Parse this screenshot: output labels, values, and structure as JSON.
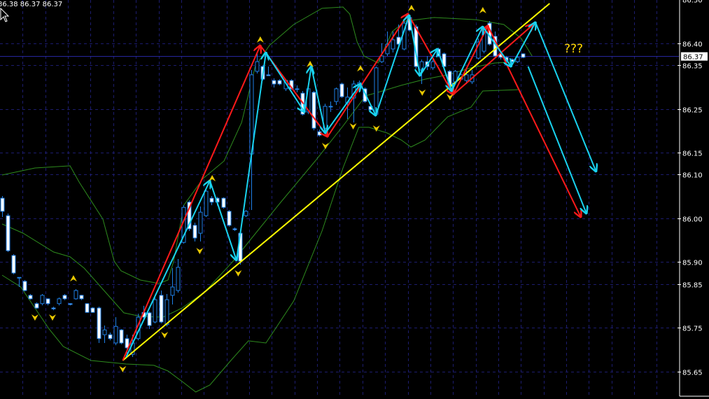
{
  "header": {
    "ohlc_readout": "86.38 86.37 86.37"
  },
  "annotation": {
    "question": "???"
  },
  "current_price": {
    "value": 86.37,
    "label": "86.37"
  },
  "colors": {
    "background": "#000000",
    "grid": "#1c1c6e",
    "bull": "#1e7fe6",
    "bear": "#ffffff",
    "bands": "#2e8b1e",
    "zigzag": "#ff1a1a",
    "swing": "#19d3f0",
    "trendline": "#ffff00",
    "fractal": "#e8c800",
    "price_line": "#2a2aa8"
  },
  "chart_data": {
    "type": "candlestick",
    "title": "",
    "xlabel": "",
    "ylabel": "",
    "ylim": [
      85.6,
      86.5
    ],
    "grid": true,
    "y_ticks": [
      "86.50",
      "86.40",
      "86.35",
      "86.25",
      "86.15",
      "86.10",
      "86.00",
      "85.90",
      "85.85",
      "85.75",
      "85.65"
    ],
    "candles_ohlc": [
      [
        86.046,
        86.051,
        86.003,
        86.016
      ],
      [
        86.006,
        86.011,
        85.923,
        85.926
      ],
      [
        85.915,
        85.918,
        85.872,
        85.875
      ],
      [
        85.865,
        85.865,
        85.843,
        85.864
      ],
      [
        85.856,
        85.859,
        85.833,
        85.835
      ],
      [
        85.824,
        85.827,
        85.814,
        85.816
      ],
      [
        85.805,
        85.808,
        85.793,
        85.795
      ],
      [
        85.805,
        85.827,
        85.801,
        85.824
      ],
      [
        85.816,
        85.817,
        85.801,
        85.805
      ],
      [
        85.795,
        85.798,
        85.79,
        85.793
      ],
      [
        85.805,
        85.819,
        85.801,
        85.816
      ],
      [
        85.824,
        85.827,
        85.813,
        85.816
      ],
      [
        85.805,
        85.806,
        85.801,
        85.803
      ],
      [
        85.816,
        85.838,
        85.814,
        85.835
      ],
      [
        85.824,
        85.825,
        85.813,
        85.816
      ],
      [
        85.805,
        85.806,
        85.784,
        85.785
      ],
      [
        85.795,
        85.797,
        85.784,
        85.785
      ],
      [
        85.795,
        85.798,
        85.715,
        85.725
      ],
      [
        85.734,
        85.755,
        85.715,
        85.745
      ],
      [
        85.734,
        85.739,
        85.721,
        85.725
      ],
      [
        85.715,
        85.774,
        85.71,
        85.753
      ],
      [
        85.745,
        85.747,
        85.712,
        85.715
      ],
      [
        85.725,
        85.734,
        85.688,
        85.704
      ],
      [
        85.689,
        85.734,
        85.683,
        85.715
      ],
      [
        85.725,
        85.782,
        85.721,
        85.774
      ],
      [
        85.785,
        85.8,
        85.771,
        85.774
      ],
      [
        85.784,
        85.787,
        85.747,
        85.755
      ],
      [
        85.763,
        85.819,
        85.76,
        85.814
      ],
      [
        85.824,
        85.835,
        85.76,
        85.763
      ],
      [
        85.757,
        85.827,
        85.753,
        85.814
      ],
      [
        85.824,
        85.886,
        85.803,
        85.843
      ],
      [
        85.835,
        85.907,
        85.83,
        85.888
      ],
      [
        85.945,
        86.03,
        85.942,
        86.025
      ],
      [
        86.037,
        86.041,
        85.971,
        85.976
      ],
      [
        85.984,
        85.99,
        85.947,
        85.955
      ],
      [
        85.966,
        86.027,
        85.947,
        86.014
      ],
      [
        86.006,
        86.067,
        86.003,
        86.062
      ],
      [
        86.046,
        86.051,
        86.03,
        86.037
      ],
      [
        86.046,
        86.049,
        86.029,
        86.037
      ],
      [
        86.046,
        86.048,
        86.022,
        86.025
      ],
      [
        86.016,
        86.019,
        85.981,
        85.984
      ],
      [
        85.976,
        85.979,
        85.971,
        85.974
      ],
      [
        85.966,
        85.971,
        85.894,
        85.902
      ],
      [
        86.006,
        86.019,
        86.003,
        86.016
      ],
      [
        86.147,
        86.339,
        86.019,
        86.328
      ],
      [
        86.336,
        86.379,
        86.331,
        86.358
      ],
      [
        86.347,
        86.35,
        86.315,
        86.318
      ],
      [
        86.328,
        86.347,
        86.326,
        86.326
      ],
      [
        86.315,
        86.32,
        86.299,
        86.307
      ],
      [
        86.315,
        86.318,
        86.304,
        86.307
      ],
      [
        86.296,
        86.318,
        86.291,
        86.315
      ],
      [
        86.315,
        86.318,
        86.294,
        86.296
      ],
      [
        86.296,
        86.304,
        86.288,
        86.296
      ],
      [
        86.286,
        86.291,
        86.235,
        86.238
      ],
      [
        86.243,
        86.299,
        86.238,
        86.296
      ],
      [
        86.288,
        86.291,
        86.201,
        86.206
      ],
      [
        86.198,
        86.203,
        86.187,
        86.19
      ],
      [
        86.206,
        86.262,
        86.203,
        86.256
      ],
      [
        86.256,
        86.267,
        86.243,
        86.256
      ],
      [
        86.267,
        86.299,
        86.259,
        86.296
      ],
      [
        86.307,
        86.31,
        86.275,
        86.278
      ],
      [
        86.264,
        86.299,
        86.227,
        86.277
      ],
      [
        86.275,
        86.315,
        86.219,
        86.307
      ],
      [
        86.296,
        86.315,
        86.291,
        86.31
      ],
      [
        86.296,
        86.299,
        86.264,
        86.267
      ],
      [
        86.256,
        86.259,
        86.243,
        86.248
      ],
      [
        86.238,
        86.347,
        86.235,
        86.344
      ],
      [
        86.358,
        86.4,
        86.355,
        86.371
      ],
      [
        86.376,
        86.427,
        86.371,
        86.398
      ],
      [
        86.387,
        86.427,
        86.379,
        86.408
      ],
      [
        86.414,
        86.443,
        86.395,
        86.398
      ],
      [
        86.387,
        86.451,
        86.384,
        86.446
      ],
      [
        86.459,
        86.464,
        86.427,
        86.43
      ],
      [
        86.438,
        86.443,
        86.342,
        86.347
      ],
      [
        86.339,
        86.363,
        86.307,
        86.358
      ],
      [
        86.358,
        86.371,
        86.339,
        86.347
      ],
      [
        86.344,
        86.363,
        86.339,
        86.358
      ],
      [
        86.387,
        86.39,
        86.368,
        86.371
      ],
      [
        86.376,
        86.379,
        86.339,
        86.347
      ],
      [
        86.336,
        86.339,
        86.299,
        86.302
      ],
      [
        86.312,
        86.339,
        86.307,
        86.336
      ],
      [
        86.318,
        86.339,
        86.315,
        86.328
      ],
      [
        86.315,
        86.339,
        86.307,
        86.328
      ],
      [
        86.312,
        86.339,
        86.307,
        86.328
      ],
      [
        86.366,
        86.411,
        86.363,
        86.403
      ],
      [
        86.382,
        86.438,
        86.377,
        86.435
      ],
      [
        86.446,
        86.451,
        86.395,
        86.398
      ],
      [
        86.416,
        86.427,
        86.368,
        86.371
      ],
      [
        86.376,
        86.379,
        86.363,
        86.368
      ],
      [
        86.368,
        86.371,
        86.355,
        86.36
      ],
      [
        86.363,
        86.366,
        86.352,
        86.358
      ],
      [
        86.358,
        86.371,
        86.355,
        86.368
      ],
      [
        86.376,
        86.377,
        86.366,
        86.368
      ]
    ],
    "bollinger_bands": {
      "upper": [
        [
          0,
          86.099
        ],
        [
          5.8,
          86.115
        ],
        [
          12,
          86.12
        ],
        [
          13.6,
          86.083
        ],
        [
          17.8,
          85.998
        ],
        [
          19.8,
          85.902
        ],
        [
          21,
          85.88
        ],
        [
          24.4,
          85.859
        ],
        [
          27.7,
          85.851
        ],
        [
          29.3,
          85.859
        ],
        [
          30.3,
          85.902
        ],
        [
          32.1,
          86.03
        ],
        [
          35.5,
          86.091
        ],
        [
          39.2,
          86.131
        ],
        [
          42.3,
          86.219
        ],
        [
          44.7,
          86.347
        ],
        [
          47.2,
          86.395
        ],
        [
          51.5,
          86.443
        ],
        [
          56.5,
          86.48
        ],
        [
          60.2,
          86.483
        ],
        [
          61.4,
          86.467
        ],
        [
          62.7,
          86.403
        ],
        [
          63.9,
          86.371
        ],
        [
          66.4,
          86.355
        ],
        [
          68.9,
          86.427
        ],
        [
          71.3,
          86.451
        ],
        [
          76.3,
          86.459
        ],
        [
          83.7,
          86.454
        ],
        [
          88.6,
          86.443
        ],
        [
          91.7,
          86.411
        ],
        [
          93.6,
          86.371
        ]
      ],
      "middle": [
        [
          0,
          85.987
        ],
        [
          3.7,
          85.966
        ],
        [
          9.1,
          85.923
        ],
        [
          12,
          85.912
        ],
        [
          14.5,
          85.886
        ],
        [
          18.2,
          85.832
        ],
        [
          21.5,
          85.784
        ],
        [
          24.4,
          85.776
        ],
        [
          28.4,
          85.774
        ],
        [
          31.8,
          85.795
        ],
        [
          35.8,
          85.832
        ],
        [
          40.8,
          85.902
        ],
        [
          44.1,
          85.955
        ],
        [
          49.1,
          86.035
        ],
        [
          55.3,
          86.131
        ],
        [
          60.2,
          86.211
        ],
        [
          64.2,
          86.28
        ],
        [
          66.4,
          86.288
        ],
        [
          70.5,
          86.304
        ],
        [
          74.7,
          86.318
        ],
        [
          78.7,
          86.328
        ],
        [
          82.8,
          86.344
        ],
        [
          87,
          86.355
        ],
        [
          91.1,
          86.358
        ]
      ],
      "lower": [
        [
          0,
          85.87
        ],
        [
          3.3,
          85.843
        ],
        [
          5.8,
          85.795
        ],
        [
          8.3,
          85.747
        ],
        [
          10.8,
          85.707
        ],
        [
          15.7,
          85.675
        ],
        [
          21.9,
          85.667
        ],
        [
          26.8,
          85.664
        ],
        [
          29.3,
          85.651
        ],
        [
          31.8,
          85.627
        ],
        [
          34.2,
          85.603
        ],
        [
          36.7,
          85.619
        ],
        [
          40.4,
          85.675
        ],
        [
          43.5,
          85.72
        ],
        [
          46.6,
          85.715
        ],
        [
          51.5,
          85.811
        ],
        [
          56.5,
          85.971
        ],
        [
          60.2,
          86.115
        ],
        [
          63,
          86.208
        ],
        [
          64.8,
          86.208
        ],
        [
          68,
          86.195
        ],
        [
          70.5,
          86.179
        ],
        [
          72.2,
          86.163
        ],
        [
          74.7,
          86.179
        ],
        [
          78.7,
          86.232
        ],
        [
          82.8,
          86.254
        ],
        [
          84.9,
          86.291
        ],
        [
          91.1,
          86.294
        ]
      ]
    },
    "zigzag_red": [
      [
        [
          21.3,
          85.675
        ],
        [
          45.6,
          86.395
        ]
      ],
      [
        [
          45.6,
          86.395
        ],
        [
          57.5,
          86.187
        ]
      ],
      [
        [
          57.5,
          86.187
        ],
        [
          71.7,
          86.467
        ]
      ],
      [
        [
          71.7,
          86.467
        ],
        [
          79.7,
          86.283
        ]
      ],
      [
        [
          79.7,
          86.283
        ],
        [
          85.8,
          86.44
        ]
      ],
      [
        [
          85.8,
          86.44
        ],
        [
          102.2,
          86.003
        ]
      ],
      [
        [
          79.7,
          86.283
        ],
        [
          93.8,
          86.443
        ]
      ]
    ],
    "swings_cyan": [
      [
        [
          21.9,
          85.683
        ],
        [
          36.7,
          86.086
        ]
      ],
      [
        [
          36.7,
          86.086
        ],
        [
          41.4,
          85.904
        ]
      ],
      [
        [
          41.4,
          85.904
        ],
        [
          46.6,
          86.379
        ]
      ],
      [
        [
          46.6,
          86.379
        ],
        [
          53.4,
          86.243
        ]
      ],
      [
        [
          53.4,
          86.243
        ],
        [
          54.6,
          86.347
        ]
      ],
      [
        [
          54.6,
          86.347
        ],
        [
          57.1,
          86.195
        ]
      ],
      [
        [
          57.1,
          86.195
        ],
        [
          63.3,
          86.307
        ]
      ],
      [
        [
          63.3,
          86.307
        ],
        [
          66,
          86.235
        ]
      ],
      [
        [
          66,
          86.235
        ],
        [
          71.9,
          86.464
        ]
      ],
      [
        [
          71.9,
          86.464
        ],
        [
          73.8,
          86.326
        ]
      ],
      [
        [
          73.8,
          86.326
        ],
        [
          76.9,
          86.387
        ]
      ],
      [
        [
          76.9,
          86.387
        ],
        [
          79.4,
          86.291
        ]
      ],
      [
        [
          79.4,
          86.291
        ],
        [
          84.9,
          86.438
        ]
      ],
      [
        [
          84.9,
          86.438
        ],
        [
          89.9,
          86.347
        ]
      ],
      [
        [
          89.9,
          86.347
        ],
        [
          94.2,
          86.448
        ]
      ],
      [
        [
          94.2,
          86.448
        ],
        [
          104.9,
          86.107
        ]
      ],
      [
        [
          92.9,
          86.347
        ],
        [
          103.2,
          86.011
        ]
      ]
    ],
    "trendline": [
      [
        21.3,
        85.675
      ],
      [
        96.7,
        86.491
      ]
    ],
    "fractals_up": [
      [
        12.6,
        85.854
      ],
      [
        37.1,
        86.083
      ],
      [
        45.6,
        86.4
      ],
      [
        54.4,
        86.344
      ],
      [
        63.3,
        86.334
      ],
      [
        72.3,
        86.472
      ],
      [
        84.9,
        86.467
      ]
    ],
    "fractals_down": [
      [
        5.8,
        85.782
      ],
      [
        8.9,
        85.782
      ],
      [
        21.3,
        85.664
      ],
      [
        28.7,
        85.742
      ],
      [
        34.9,
        85.934
      ],
      [
        41.7,
        85.883
      ],
      [
        57.1,
        86.174
      ],
      [
        62,
        86.219
      ],
      [
        66.1,
        86.214
      ],
      [
        74.2,
        86.296
      ],
      [
        79.1,
        86.286
      ]
    ]
  }
}
